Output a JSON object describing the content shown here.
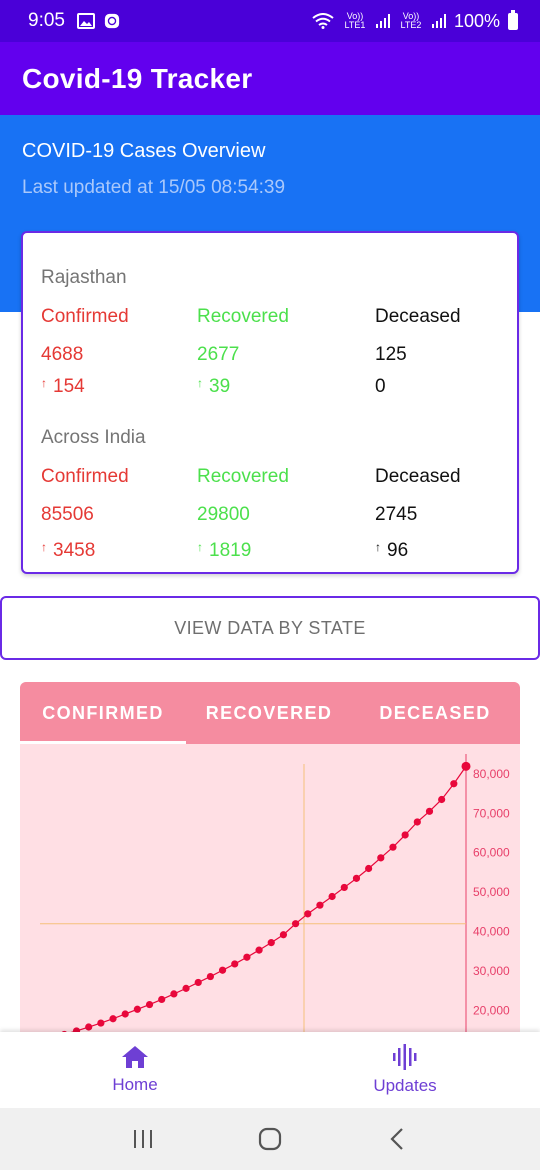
{
  "status_bar": {
    "time": "9:05",
    "battery": "100%",
    "sim1": "Vo)) LTE1",
    "sim2": "Vo)) LTE2"
  },
  "app_bar": {
    "title": "Covid-19 Tracker"
  },
  "overview": {
    "title": "COVID-19 Cases Overview",
    "last_updated": "Last updated at 15/05 08:54:39"
  },
  "stats": {
    "state": {
      "name": "Rajasthan",
      "confirmed_label": "Confirmed",
      "recovered_label": "Recovered",
      "deceased_label": "Deceased",
      "confirmed": "4688",
      "recovered": "2677",
      "deceased": "125",
      "confirmed_delta": "154",
      "recovered_delta": "39",
      "deceased_delta": "0"
    },
    "india": {
      "name": "Across India",
      "confirmed_label": "Confirmed",
      "recovered_label": "Recovered",
      "deceased_label": "Deceased",
      "confirmed": "85506",
      "recovered": "29800",
      "deceased": "2745",
      "confirmed_delta": "3458",
      "recovered_delta": "1819",
      "deceased_delta": "96"
    },
    "up_arrow": "↑"
  },
  "state_button": {
    "label": "VIEW DATA BY STATE"
  },
  "chart_tabs": [
    "CONFIRMED",
    "RECOVERED",
    "DECEASED"
  ],
  "chart_data": {
    "type": "line",
    "title": "",
    "xlabel": "",
    "ylabel": "",
    "y_ticks": [
      "20,000",
      "30,000",
      "40,000",
      "50,000",
      "60,000",
      "70,000",
      "80,000"
    ],
    "y_tick_values": [
      20000,
      30000,
      40000,
      50000,
      60000,
      70000,
      80000
    ],
    "ylim": [
      12000,
      82500
    ],
    "series": [
      {
        "values": [
          12300,
          13100,
          13900,
          14800,
          15800,
          16800,
          17900,
          19100,
          20300,
          21500,
          22800,
          24200,
          25600,
          27100,
          28600,
          30200,
          31800,
          33500,
          35300,
          37200,
          39200,
          42000,
          44500,
          46700,
          48900,
          51200,
          53500,
          56000,
          58700,
          61400,
          64500,
          67800,
          70500,
          73500,
          77500,
          81900
        ]
      }
    ],
    "crosshair_value": 42000,
    "grid": false,
    "colors": {
      "line": "#e8083b",
      "crosshair": "#f5c07a",
      "axis": "#e8406a",
      "tick_text": "#e8406a",
      "background": "#ffdfe4"
    }
  },
  "bottom_nav": {
    "items": [
      {
        "label": "Home",
        "icon": "home-icon"
      },
      {
        "label": "Updates",
        "icon": "updates-icon"
      }
    ]
  },
  "colors": {
    "status_bar": "#4a00d8",
    "app_bar": "#6200ee",
    "overview": "#1872f4",
    "card_border": "#6a2ae6",
    "confirmed": "#e53935",
    "recovered": "#4ce04c",
    "tab_bar": "#f58ca0"
  }
}
